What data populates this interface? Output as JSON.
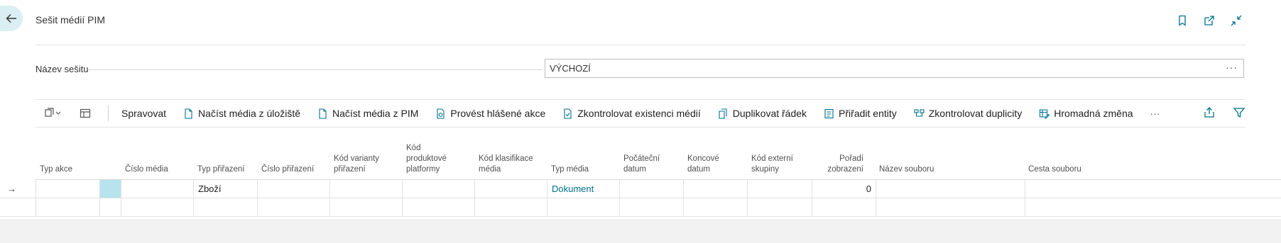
{
  "header": {
    "title": "Sešit médií PIM",
    "icons": [
      "bookmark-icon",
      "open-new-window-icon",
      "collapse-icon"
    ]
  },
  "field": {
    "label": "Název sešitu",
    "value": "VÝCHOZÍ"
  },
  "toolbar": {
    "items": [
      {
        "label": "Spravovat",
        "icon": ""
      },
      {
        "label": "Načíst média z úložiště",
        "icon": "document-icon"
      },
      {
        "label": "Načíst média z PIM",
        "icon": "document-icon"
      },
      {
        "label": "Provést hlášené akce",
        "icon": "document-action-icon"
      },
      {
        "label": "Zkontrolovat existenci médií",
        "icon": "document-check-icon"
      },
      {
        "label": "Duplikovat řádek",
        "icon": "copy-icon"
      },
      {
        "label": "Přiřadit entity",
        "icon": "assign-icon"
      },
      {
        "label": "Zkontrolovat duplicity",
        "icon": "duplicates-icon"
      },
      {
        "label": "Hromadná změna",
        "icon": "bulk-edit-icon"
      }
    ],
    "more": "···"
  },
  "grid": {
    "columns": [
      {
        "key": "typ_akce",
        "label": "Typ akce"
      },
      {
        "key": "cislo_media",
        "label": "Číslo média"
      },
      {
        "key": "typ_prirazeni",
        "label": "Typ přiřazení"
      },
      {
        "key": "cislo_prirazeni",
        "label": "Číslo přiřazení"
      },
      {
        "key": "kod_varianty",
        "label": "Kód varianty přiřazení"
      },
      {
        "key": "kod_platformy",
        "label": "Kód produktové platformy"
      },
      {
        "key": "kod_klasifikace",
        "label": "Kód klasifikace média"
      },
      {
        "key": "typ_media",
        "label": "Typ média"
      },
      {
        "key": "pocatecni",
        "label": "Počáteční datum"
      },
      {
        "key": "koncove",
        "label": "Koncové datum"
      },
      {
        "key": "externi",
        "label": "Kód externí skupiny"
      },
      {
        "key": "poradi",
        "label": "Pořadí zobrazení"
      },
      {
        "key": "nazev",
        "label": "Název souboru"
      },
      {
        "key": "cesta",
        "label": "Cesta souboru"
      }
    ],
    "rows": [
      {
        "indicator": "→",
        "typ_prirazeni": "Zboží",
        "typ_media": "Dokument",
        "poradi": "0"
      },
      {
        "indicator": ""
      }
    ]
  },
  "colors": {
    "accent": "#00718f",
    "selected_cell": "#b6e3ee",
    "back_button": "#dbeef3"
  }
}
